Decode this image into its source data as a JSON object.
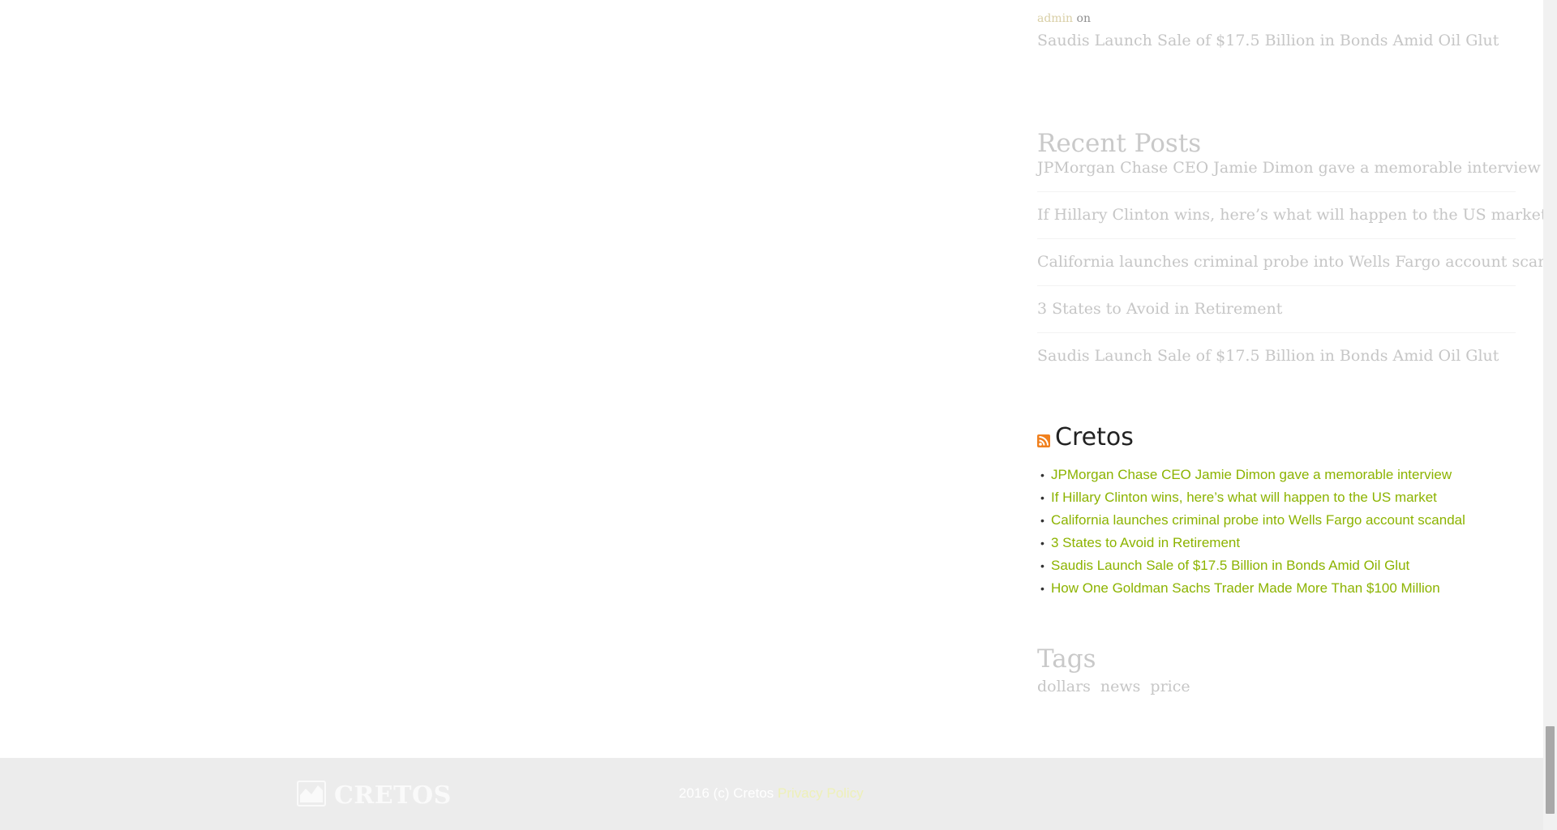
{
  "recent_comments": {
    "author": "admin",
    "on_text": "on",
    "post": "Saudis Launch Sale of $17.5 Billion in Bonds Amid Oil Glut"
  },
  "recent_posts": {
    "heading": "Recent Posts",
    "items": [
      "JPMorgan Chase CEO Jamie Dimon gave a memorable interview",
      "If Hillary Clinton wins, here’s what will happen to the US market",
      "California launches criminal probe into Wells Fargo account scandal",
      "3 States to Avoid in Retirement",
      "Saudis Launch Sale of $17.5 Billion in Bonds Amid Oil Glut"
    ]
  },
  "rss": {
    "title": "Cretos",
    "icon": "rss-icon",
    "items": [
      "JPMorgan Chase CEO Jamie Dimon gave a memorable interview",
      "If Hillary Clinton wins, here’s what will happen to the US market",
      "California launches criminal probe into Wells Fargo account scandal",
      "3 States to Avoid in Retirement",
      "Saudis Launch Sale of $17.5 Billion in Bonds Amid Oil Glut",
      "How One Goldman Sachs Trader Made More Than $100 Million"
    ]
  },
  "tags": {
    "heading": "Tags",
    "items": [
      "dollars",
      "news",
      "price"
    ]
  },
  "footer": {
    "logo_text": "CRETOS",
    "copyright": "2016 (c) Cretos",
    "privacy_link": "Privacy Policy"
  },
  "colors": {
    "link_green": "#8cb300",
    "footer_bg": "#ececec"
  }
}
